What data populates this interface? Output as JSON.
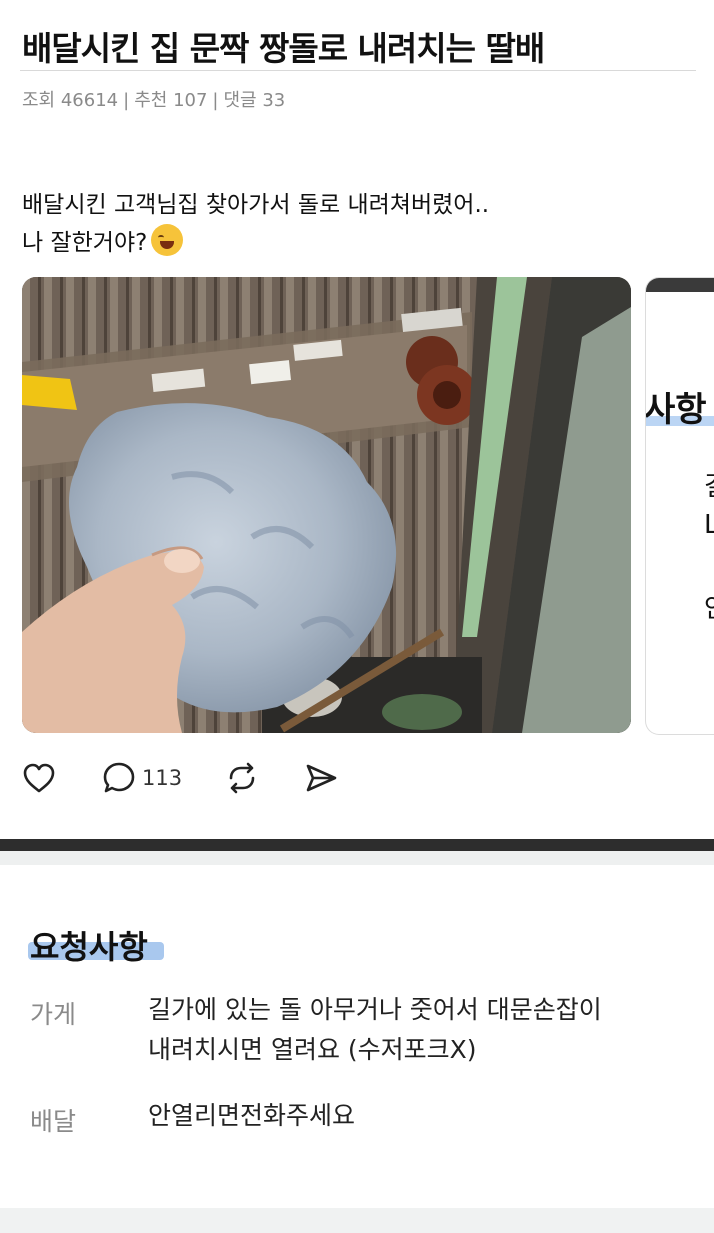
{
  "post": {
    "title": "배달시킨 집 문짝 짱돌로 내려치는 딸배",
    "meta": {
      "views_label": "조회",
      "views": "46614",
      "recommend_label": "추천",
      "recommend": "107",
      "comments_label": "댓글",
      "comments": "33"
    },
    "body_line1": "배달시킨 고객님집 찾아가서 돌로 내려쳐버렸어..",
    "body_line2": "나 잘한거야?",
    "emoji": "rolling-on-floor-laughing-emoji"
  },
  "media_preview": {
    "heading_fragment": "사항",
    "chars": [
      "결",
      "L",
      "안"
    ]
  },
  "actions": {
    "like_icon": "heart-icon",
    "reply_icon": "speech-bubble-icon",
    "reply_count": "113",
    "repost_icon": "repost-icon",
    "share_icon": "send-icon"
  },
  "request_card": {
    "title": "요청사항",
    "rows": [
      {
        "label": "가게",
        "value_line1": "길가에 있는 돌 아무거나 줏어서 대문손잡이",
        "value_line2": "내려치시면 열려요 (수저포크X)"
      },
      {
        "label": "배달",
        "value_line1": "안열리면전화주세요"
      }
    ]
  },
  "colors": {
    "meta_gray": "#8a8a8a",
    "highlight_blue": "#a9c8ee",
    "dark_divider": "#2d2d2d"
  }
}
